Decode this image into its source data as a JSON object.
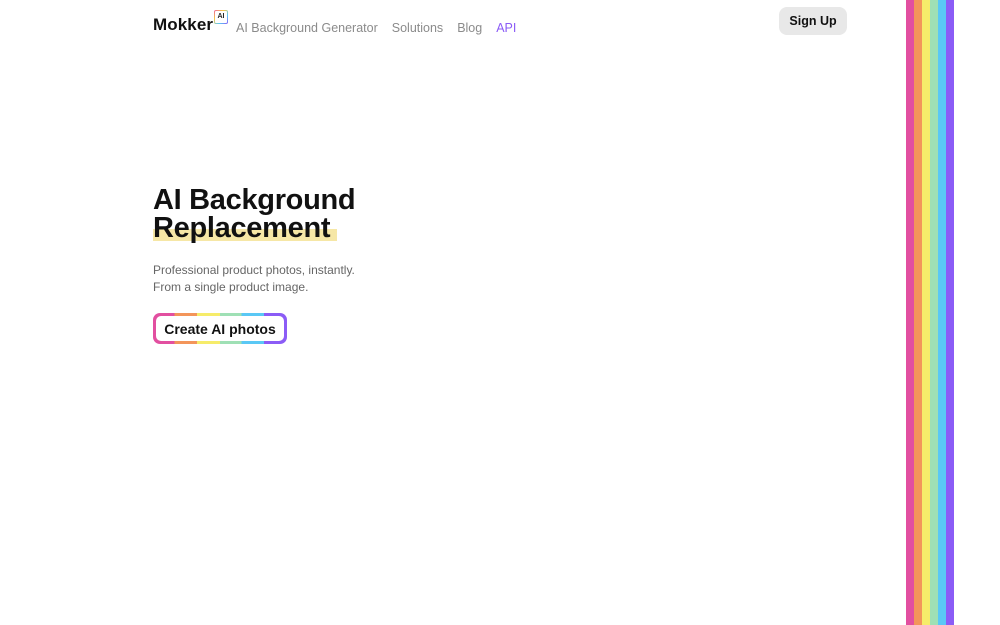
{
  "header": {
    "logo_text": "Mokker",
    "logo_badge": "AI",
    "nav": [
      {
        "label": "AI Background Generator"
      },
      {
        "label": "Solutions"
      },
      {
        "label": "Blog"
      },
      {
        "label": "API"
      }
    ],
    "signup_label": "Sign Up"
  },
  "hero": {
    "title_line1": "AI Background",
    "title_line2": "Replacement",
    "subtitle_line1": "Professional product photos, instantly.",
    "subtitle_line2": "From a single product image.",
    "cta_label": "Create AI photos"
  },
  "colors": {
    "accent": "#8b5cf6",
    "highlight": "#f6e7a6",
    "stripes": [
      "#e24fa0",
      "#f3955a",
      "#f6ec6a",
      "#9fe0b5",
      "#5ac8f5",
      "#8b5cf6"
    ]
  }
}
